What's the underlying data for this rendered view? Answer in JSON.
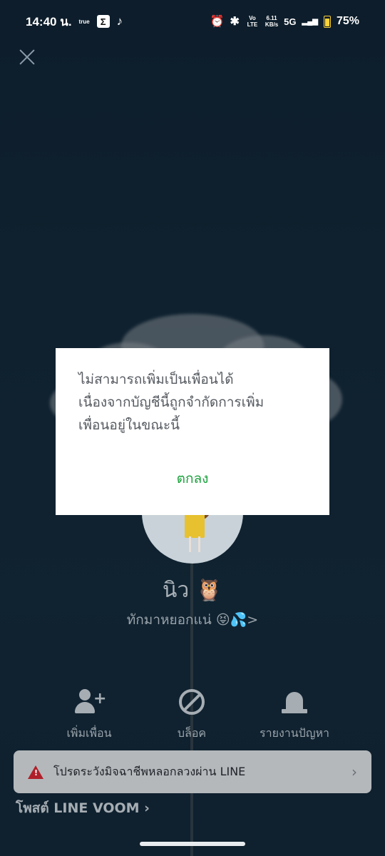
{
  "status_bar": {
    "time": "14:40 น.",
    "carrier_label": "true",
    "sigma_label": "Σ",
    "tiktok_label": "♪",
    "alarm_label": "⏰",
    "bluetooth_label": "✱",
    "volte_label": "Vo LTE",
    "speed_value": "6.11",
    "speed_unit": "KB/s",
    "network_label": "5G",
    "signal_label": "▂▄▆",
    "battery_percent": "75%"
  },
  "profile": {
    "name": "นิว 🦉",
    "status_message": "ทักมาหยอกแน่ 😝💦>"
  },
  "actions": [
    {
      "label": "เพิ่มเพื่อน",
      "icon": "add-friend-icon"
    },
    {
      "label": "บล็อค",
      "icon": "block-icon"
    },
    {
      "label": "รายงานปัญหา",
      "icon": "report-icon"
    }
  ],
  "warning_banner": {
    "text": "โปรดระวังมิจฉาชีพหลอกลวงผ่าน LINE",
    "arrow": "›"
  },
  "voom": {
    "label": "โพสต์ LINE VOOM ›"
  },
  "dialog": {
    "lines": [
      "ไม่สามารถเพิ่มเป็นเพื่อนได้",
      "เนื่องจากบัญชีนี้ถูกจำกัดการเพิ่ม",
      "เพื่อนอยู่ในขณะนี้"
    ],
    "ok_label": "ตกลง"
  },
  "colors": {
    "accent_ok": "#19a23b",
    "warning_red": "#b0202a"
  }
}
